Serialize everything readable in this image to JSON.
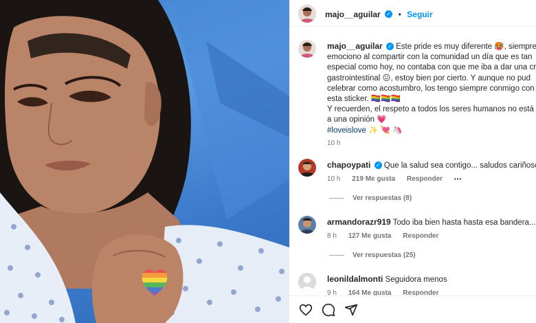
{
  "post": {
    "author": "majo__aguilar",
    "follow_label": "Seguir",
    "caption_lines": [
      "Este pride es muy diferente 🥵, siempre m",
      "emociono al compartir con la comunidad un día que es tan",
      "especial como hoy, no contaba con que me iba a dar una cr",
      "gastrointestinal 😖, estoy bien por cierto. Y aunque no pud",
      "celebrar como acostumbro, los tengo siempre conmigo con",
      "esta sticker. 🏳️‍🌈🏳️‍🌈🏳️‍🌈",
      "Y recuerden, el respeto a todos los seres humanos no está s",
      "a una opinión 💗"
    ],
    "hashtag": "#loveislove",
    "hashtag_emojis": "✨ 💘 🦄",
    "time": "10 h"
  },
  "comments": [
    {
      "user": "chapoypati",
      "verified": true,
      "text": "Que la salud sea contigo... saludos cariñosos.",
      "time": "10 h",
      "likes": "219 Me gusta",
      "reply": "Responder",
      "more": "•••",
      "view_replies": "Ver respuestas (8)"
    },
    {
      "user": "armandorazr919",
      "verified": false,
      "text": "Todo iba bien hasta hasta esa bandera... by",
      "time": "8 h",
      "likes": "127 Me gusta",
      "reply": "Responder",
      "view_replies": "Ver respuestas (25)"
    },
    {
      "user": "leonildalmonti",
      "verified": false,
      "text": "Seguidora menos",
      "time": "9 h",
      "likes": "164 Me gusta",
      "reply": "Responder"
    }
  ],
  "icons": {
    "verified": "verified-badge-icon",
    "like": "heart-icon",
    "comment": "comment-icon",
    "share": "share-icon"
  },
  "colors": {
    "link_blue": "#0095f6",
    "hashtag": "#00376b",
    "muted": "#737373"
  }
}
